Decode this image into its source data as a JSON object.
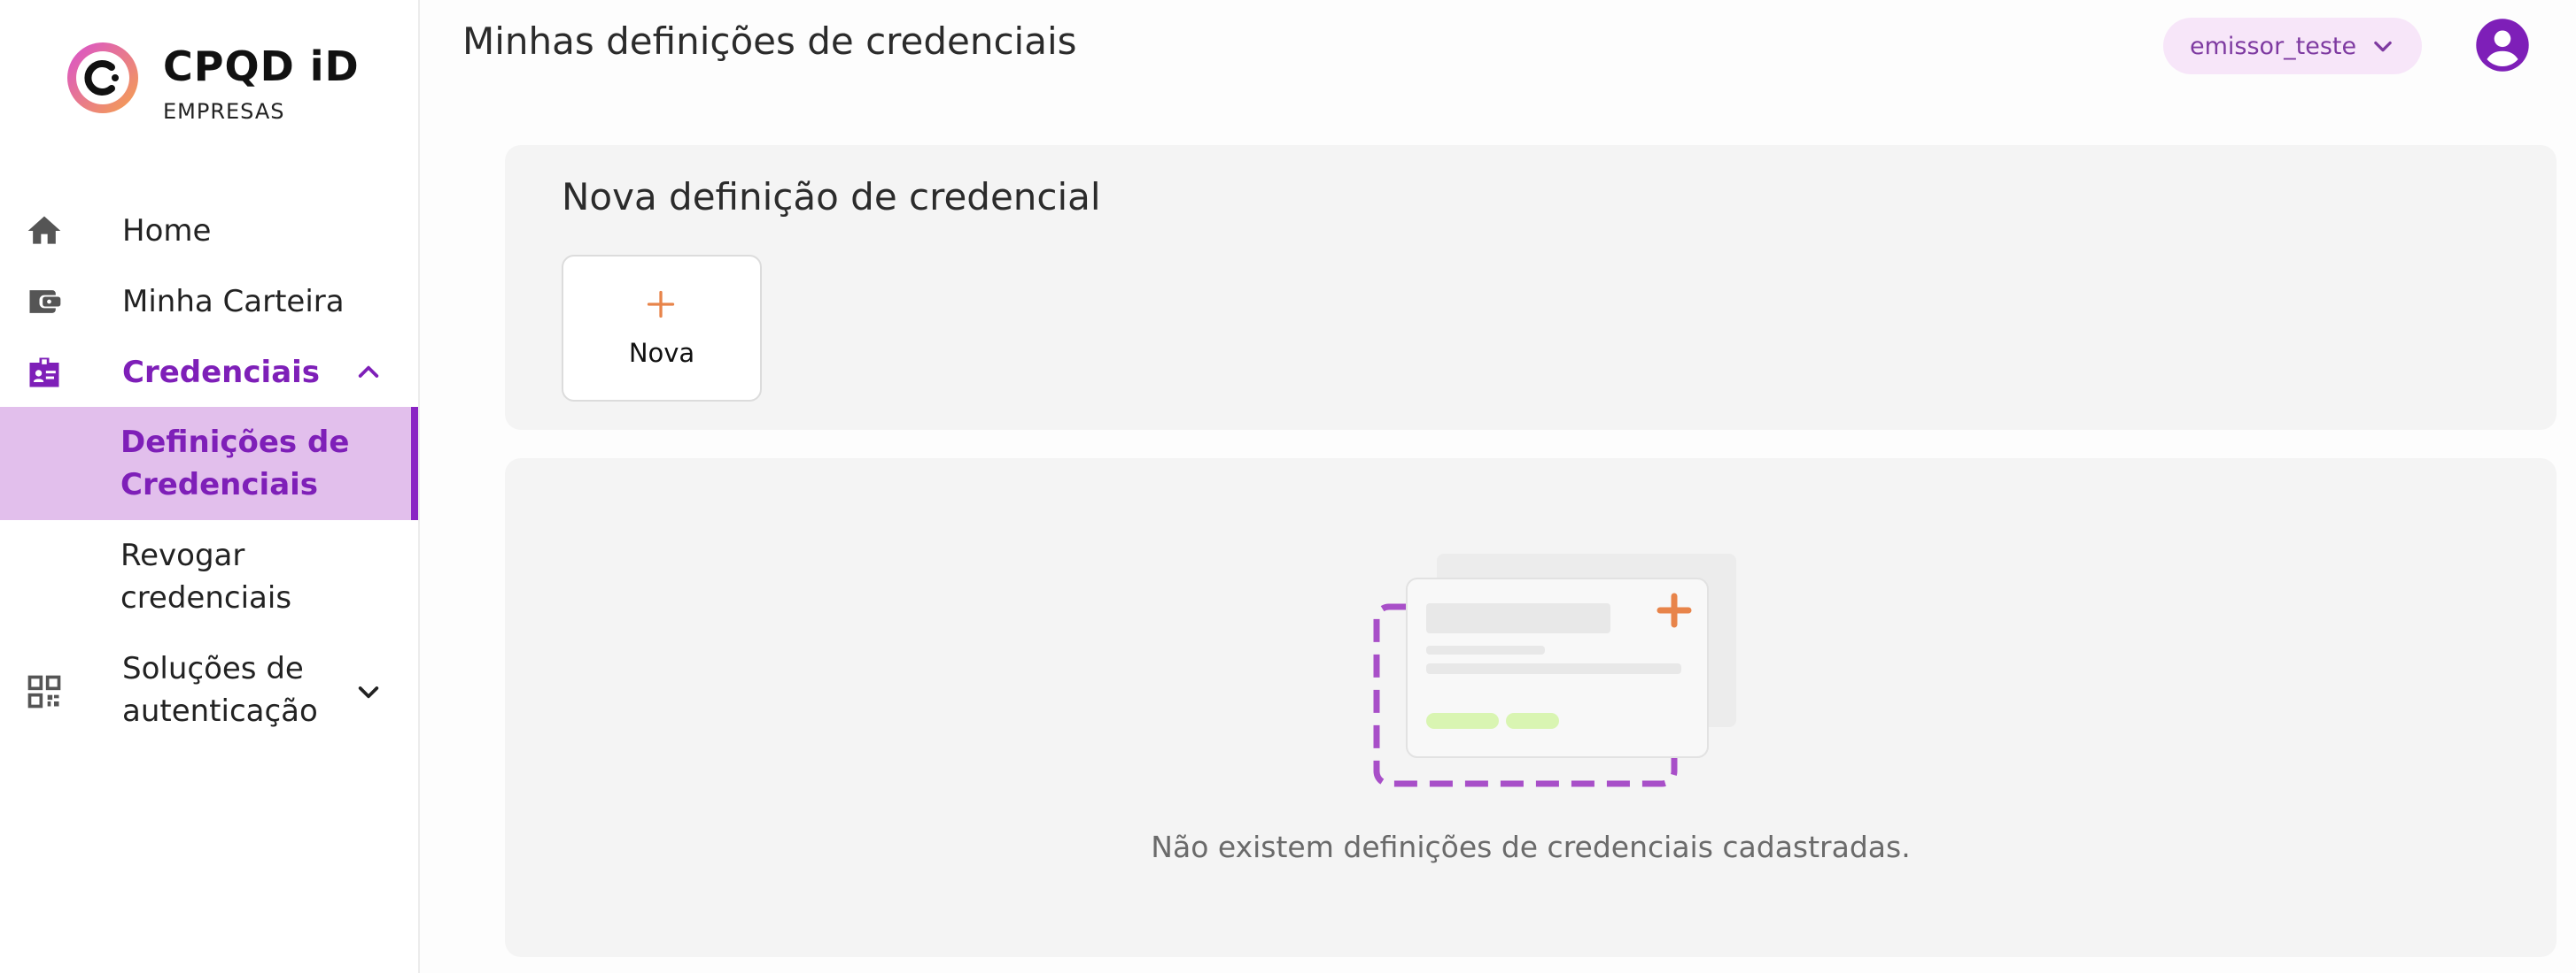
{
  "brand": {
    "name": "CPQD iD",
    "subtitle": "EMPRESAS"
  },
  "sidebar": {
    "items": [
      {
        "label": "Home",
        "icon": "home-icon"
      },
      {
        "label": "Minha Carteira",
        "icon": "wallet-icon"
      },
      {
        "label": "Credenciais",
        "icon": "badge-icon",
        "expanded": true,
        "children": [
          {
            "label": "Definições de Credenciais",
            "selected": true
          },
          {
            "label": "Revogar credenciais",
            "selected": false
          }
        ]
      },
      {
        "label": "Soluções de autenticação",
        "icon": "qr-code-icon",
        "expanded": false
      }
    ]
  },
  "header": {
    "title": "Minhas definições de credenciais",
    "user_select": "emissor_teste",
    "avatar_icon": "account-circle-icon"
  },
  "new_section": {
    "title": "Nova definição de credencial",
    "new_button": "Nova"
  },
  "empty_state": {
    "message": "Não existem definições de credenciais cadastradas."
  },
  "colors": {
    "accent": "#8a24c4",
    "selected_bg": "#e2bfec",
    "orange": "#e8844a",
    "dash": "#a84fc8"
  }
}
